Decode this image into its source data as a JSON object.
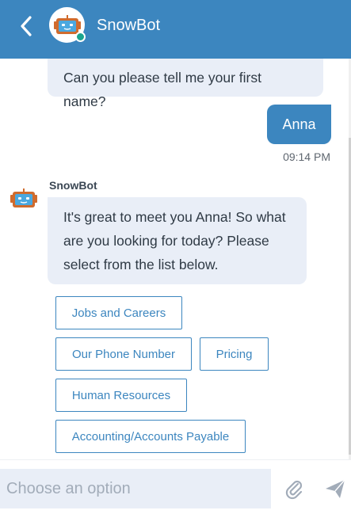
{
  "header": {
    "title": "SnowBot",
    "status": "online",
    "colors": {
      "header_bg": "#3c86bf",
      "online": "#1aa58e"
    }
  },
  "messages": [
    {
      "from": "bot",
      "text": "Can you please tell me your first name?"
    },
    {
      "from": "user",
      "text": "Anna",
      "time": "09:14 PM"
    },
    {
      "from": "bot",
      "sender": "SnowBot",
      "text": "It's great to meet you Anna! So what are you looking for today? Please select from the list below."
    }
  ],
  "options": [
    "Jobs and Careers",
    "Our Phone Number",
    "Pricing",
    "Human Resources",
    "Accounting/Accounts Payable"
  ],
  "footer": {
    "placeholder": "Choose an option",
    "icons": [
      "paperclip-icon",
      "send-icon"
    ]
  }
}
